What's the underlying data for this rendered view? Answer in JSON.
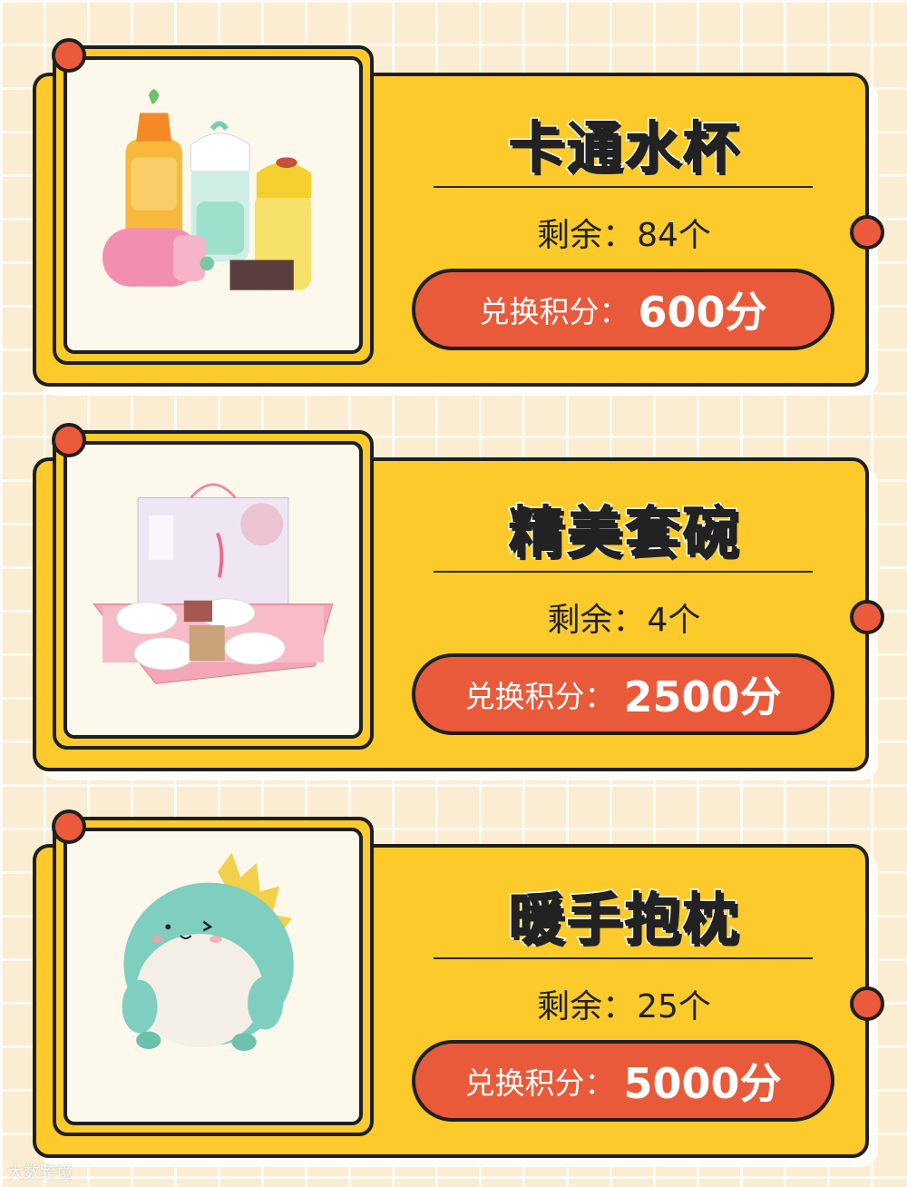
{
  "products": [
    {
      "name": "卡通水杯",
      "stock_label": "剩余：",
      "stock_value": "84个",
      "price_label": "兑换积分：",
      "price_value": "600分"
    },
    {
      "name": "精美套碗",
      "stock_label": "剩余：",
      "stock_value": "4个",
      "price_label": "兑换积分：",
      "price_value": "2500分"
    },
    {
      "name": "暖手抱枕",
      "stock_label": "剩余：",
      "stock_value": "25个",
      "price_label": "兑换积分：",
      "price_value": "5000分"
    }
  ],
  "watermark": "大数跨境",
  "colors": {
    "background": "#fbedd2",
    "card": "#fdca2c",
    "accent": "#e85a3a",
    "outline": "#1f1f1f"
  }
}
